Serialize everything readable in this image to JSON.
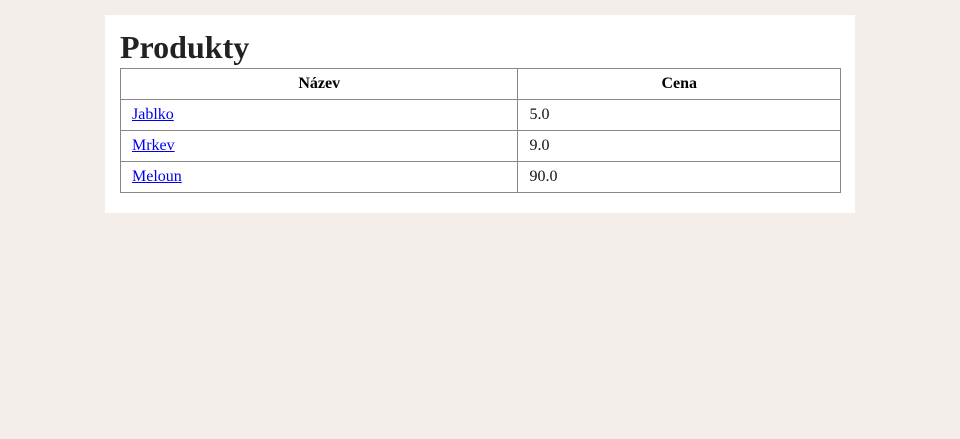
{
  "page": {
    "title": "Produkty"
  },
  "table": {
    "headers": {
      "name": "Název",
      "price": "Cena"
    },
    "rows": [
      {
        "name": "Jablko",
        "price": "5.0"
      },
      {
        "name": "Mrkev",
        "price": "9.0"
      },
      {
        "name": "Meloun",
        "price": "90.0"
      }
    ]
  },
  "colors": {
    "background": "#f3eee9",
    "card": "#ffffff",
    "link": "#0000ee",
    "border": "#888888"
  }
}
